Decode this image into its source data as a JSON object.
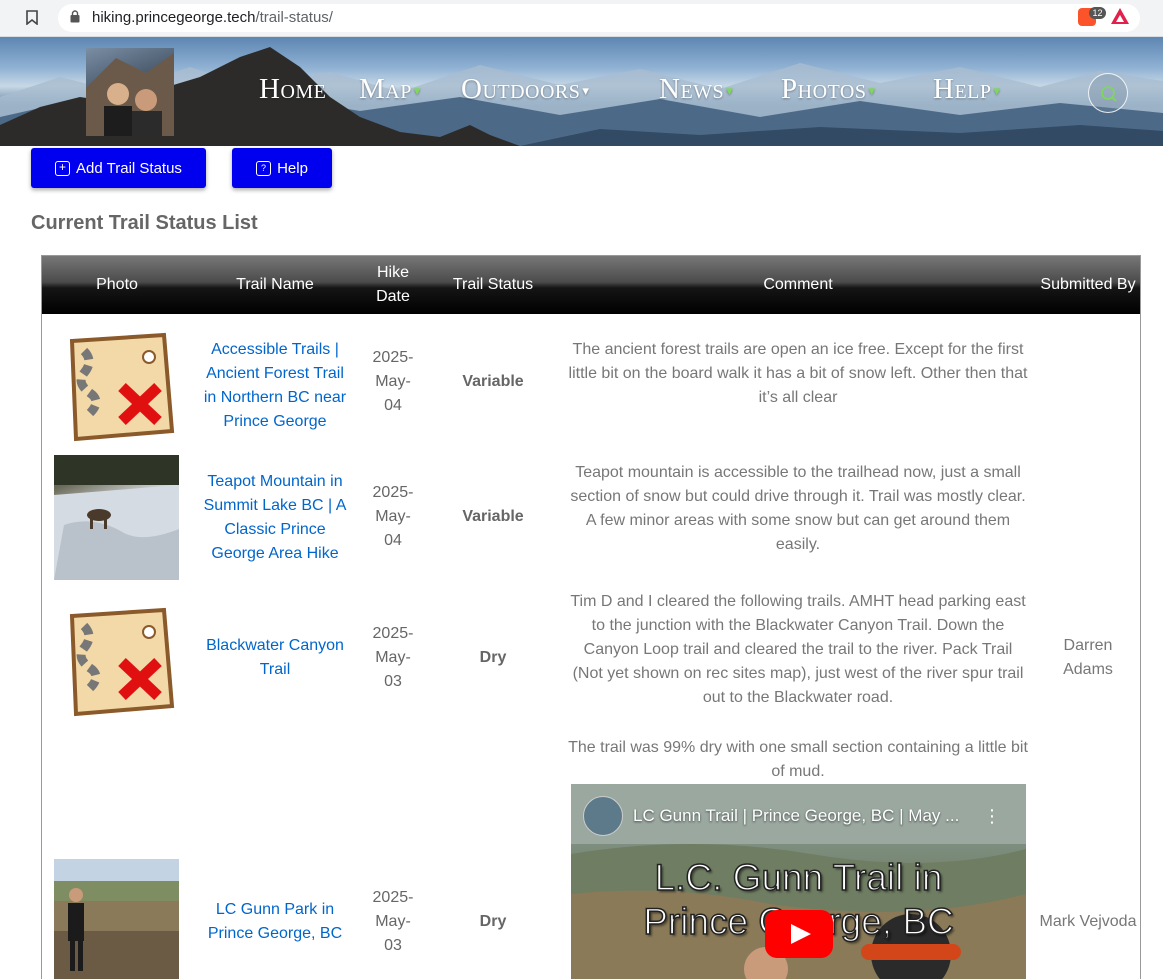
{
  "browser": {
    "url_host": "hiking.princegeorge.tech",
    "url_path": "/trail-status/",
    "ext_badge": "12"
  },
  "nav": {
    "items": [
      {
        "label": "Home",
        "caret": false
      },
      {
        "label": "Map",
        "caret": true
      },
      {
        "label": "Outdoors",
        "caret": true
      },
      {
        "label": "News",
        "caret": true
      },
      {
        "label": "Photos",
        "caret": true
      },
      {
        "label": "Help",
        "caret": true
      }
    ],
    "caret_glyph": "▾"
  },
  "buttons": {
    "add_trail_status": "Add Trail Status",
    "help": "Help"
  },
  "list_title": "Current Trail Status List",
  "table": {
    "headers": {
      "photo": "Photo",
      "trail_name": "Trail Name",
      "hike_date": "Hike Date",
      "trail_status": "Trail Status",
      "comment": "Comment",
      "submitted_by": "Submitted By"
    },
    "rows": [
      {
        "trail": "Accessible Trails | Ancient Forest Trail in Northern BC near Prince George",
        "date": "2025-May-04",
        "date_parts": [
          "2025-",
          "May-",
          "04"
        ],
        "status": "Variable",
        "comment": "The ancient forest trails are open an ice free. Except for the first little bit on the board walk it has a bit of snow left. Other then that it’s all clear",
        "submitted_by": "",
        "photo": "map-placeholder-icon"
      },
      {
        "trail": "Teapot Mountain in Summit Lake BC | A Classic Prince George Area Hike",
        "date": "2025-May-04",
        "date_parts": [
          "2025-",
          "May-",
          "04"
        ],
        "status": "Variable",
        "comment": "Teapot mountain is accessible to the trailhead now, just a small section of snow but could drive through it. Trail was mostly clear. A few minor areas with some snow but can get around them easily.",
        "submitted_by": "",
        "photo": "dog-on-snow-photo"
      },
      {
        "trail": "Blackwater Canyon Trail",
        "date": "2025-May-03",
        "date_parts": [
          "2025-",
          "May-",
          "03"
        ],
        "status": "Dry",
        "comment": "Tim D and I cleared the following trails. AMHT head parking east to the junction with the Blackwater Canyon Trail. Down the Canyon Loop trail and cleared the trail to the river. Pack Trail (Not yet shown on rec sites map), just west of the river spur trail out to the Blackwater road.",
        "submitted_by": "Darren Adams",
        "photo": "map-placeholder-icon"
      },
      {
        "trail": "LC Gunn Park in Prince George, BC",
        "date": "2025-May-03",
        "date_parts": [
          "2025-",
          "May-",
          "03"
        ],
        "status": "Dry",
        "comment": "The trail was 99% dry with one small section containing a little bit of mud.",
        "submitted_by": "Mark Vejvoda",
        "photo": "hiker-overlook-photo",
        "video": {
          "title": "LC Gunn Trail | Prince George, BC | May ...",
          "overlay_line1": "L.C. Gunn Trail in",
          "overlay_line2": "Prince George, BC"
        }
      }
    ]
  },
  "colors": {
    "button_blue": "#0000ee",
    "link_blue": "#0066cc",
    "caret_green": "#7ed957",
    "youtube_red": "#ff0000"
  }
}
